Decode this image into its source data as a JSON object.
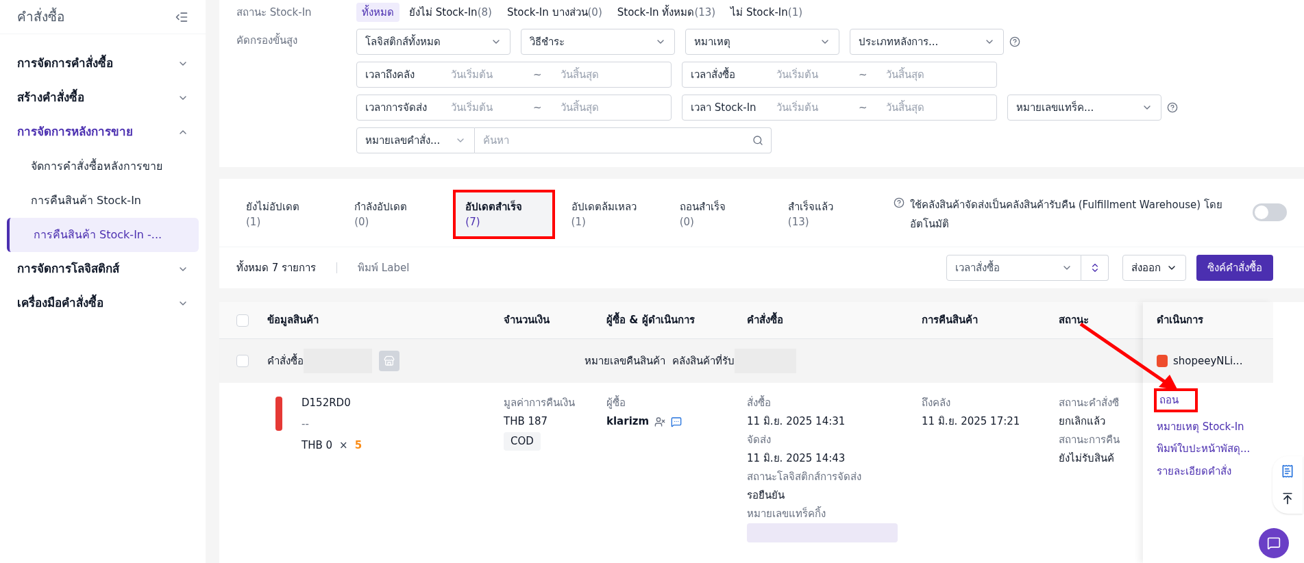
{
  "sidebar": {
    "title": "คำสั่งซื้อ",
    "items": [
      {
        "label": "การจัดการคำสั่งซื้อ",
        "expanded": false
      },
      {
        "label": "สร้างคำสั่งซื้อ",
        "expanded": false
      },
      {
        "label": "การจัดการหลังการขาย",
        "expanded": true,
        "children": [
          {
            "label": "จัดการคำสั่งซื้อหลังการขาย",
            "selected": false
          },
          {
            "label": "การคืนสินค้า Stock-In",
            "selected": false
          },
          {
            "label": "การคืนสินค้า Stock-In -...",
            "selected": true
          }
        ]
      },
      {
        "label": "การจัดการโลจิสติกส์",
        "expanded": false
      },
      {
        "label": "เครื่องมือคำสั่งซื้อ",
        "expanded": false
      }
    ]
  },
  "status_filter": {
    "label": "สถานะ Stock-In",
    "options": [
      {
        "label": "ทั้งหมด",
        "selected": true
      },
      {
        "label": "ยังไม่ Stock-In",
        "count": "(8)",
        "selected": false
      },
      {
        "label": "Stock-In บางส่วน",
        "count": "(0)",
        "selected": false
      },
      {
        "label": "Stock-In ทั้งหมด",
        "count": "(13)",
        "selected": false
      },
      {
        "label": "ไม่ Stock-In",
        "count": "(1)",
        "selected": false
      }
    ]
  },
  "advanced_filter": {
    "label": "คัดกรองขั้นสูง",
    "filter_lines": [
      {
        "controls": [
          {
            "kind": "select",
            "text": "โลจิสติกส์ทั้งหมด",
            "help": false
          },
          {
            "kind": "select",
            "text": "วิธีชำระ",
            "help": false
          },
          {
            "kind": "select",
            "text": "หมาเหตุ",
            "help": false
          },
          {
            "kind": "select",
            "text": "ประเภทหลังการ...",
            "help": true
          }
        ]
      },
      {
        "controls": [
          {
            "kind": "date_range",
            "text": "เวลาถึงคลัง",
            "start": "วันเริ่มต้น",
            "separator": "~",
            "end": "วันสิ้นสุด"
          },
          {
            "kind": "date_range",
            "text": "เวลาสั่งซื้อ",
            "start": "วันเริ่มต้น",
            "separator": "~",
            "end": "วันสิ้นสุด"
          }
        ]
      },
      {
        "controls": [
          {
            "kind": "date_range",
            "text": "เวลาการจัดส่ง",
            "start": "วันเริ่มต้น",
            "separator": "~",
            "end": "วันสิ้นสุด"
          },
          {
            "kind": "date_range",
            "text": "เวลา Stock-In",
            "start": "วันเริ่มต้น",
            "separator": "~",
            "end": "วันสิ้นสุด"
          },
          {
            "kind": "select",
            "text": "หมายเลขแทร็ค...",
            "help": true
          }
        ]
      },
      {
        "controls": [
          {
            "kind": "search",
            "text": "หมายเลขคำสั่ง...",
            "placeholder": "ค้นหา"
          }
        ]
      }
    ]
  },
  "tabs": [
    {
      "label": "ยังไม่อัปเดต",
      "count": "(1)",
      "selected": false,
      "annotated": false
    },
    {
      "label": "กำลังอัปเดต",
      "count": "(0)",
      "selected": false,
      "annotated": false
    },
    {
      "label": "อัปเดตสำเร็จ",
      "count": "(7)",
      "selected": true,
      "annotated": true
    },
    {
      "label": "อัปเดตล้มเหลว",
      "count": "(1)",
      "selected": false,
      "annotated": false
    },
    {
      "label": "ถอนสำเร็จ",
      "count": "(0)",
      "selected": false,
      "annotated": false
    },
    {
      "label": "สำเร็จแล้ว",
      "count": "(13)",
      "selected": false,
      "annotated": false
    }
  ],
  "auto_warehouse": {
    "text": "ใช้คลังสินค้าจัดส่งเป็นคลังสินค้ารับคืน (Fulfillment Warehouse) โดยอัตโนมัติ",
    "on": false
  },
  "toolbar": {
    "total": "ทั้งหมด 7 รายการ",
    "print_label": "พิมพ์ Label",
    "sort": "เวลาสั่งซื้อ",
    "export": "ส่งออก",
    "sync": "ซิงค์คำสั่งซื้อ"
  },
  "table": {
    "select_all_checked": false,
    "columns": [
      "ข้อมูลสินค้า",
      "จำนวนเงิน",
      "ผู้ซื้อ & ผู้ดำเนินการ",
      "คำสั่งซื้อ",
      "การคืนสินค้า",
      "สถานะ",
      "ดำเนินการ"
    ],
    "order": {
      "checked": false,
      "label": "คำสั่งซื้อ",
      "return_no_label": "หมายเลขคืนสินค้า",
      "warehouse_label": "คลังสินค้าที่รับ",
      "shop": "shopeeyNLi...",
      "item": {
        "sku": "D152RD0",
        "variant": "--",
        "price": "THB 0",
        "times": "×",
        "qty": "5",
        "refund_label": "มูลค่าการคืนเงิน",
        "refund": "THB 187",
        "payment": "COD",
        "buyer_label": "ผู้ซื้อ",
        "buyer": "klarizm",
        "order_info": [
          {
            "label": "สั่งซื้อ",
            "value": "11 มิ.ย. 2025 14:31"
          },
          {
            "label": "จัดส่ง",
            "value": "11 มิ.ย. 2025 14:43"
          },
          {
            "label": "สถานะโลจิสติกส์การจัดส่ง",
            "value": "รอยืนยัน"
          },
          {
            "label": "หมายเลขแทร็คกิ้ง"
          }
        ],
        "return_info": [
          {
            "label": "ถึงคลัง",
            "value": "11 มิ.ย. 2025 17:21"
          }
        ],
        "status_info": [
          {
            "label": "สถานะคำสั่งซื",
            "value": "ยกเลิกแล้ว"
          },
          {
            "label": "สถานะการคืน",
            "value": "ยังไม่รับสินค้"
          }
        ],
        "actions": [
          {
            "label": "ถอน",
            "annotated": true
          },
          {
            "label": "หมายเหตุ Stock-In",
            "annotated": false
          },
          {
            "label": "พิมพ์ใบปะหน้าพัสดุ...",
            "annotated": false
          },
          {
            "label": "รายละเอียดคำสั่ง",
            "annotated": false
          }
        ]
      }
    }
  }
}
